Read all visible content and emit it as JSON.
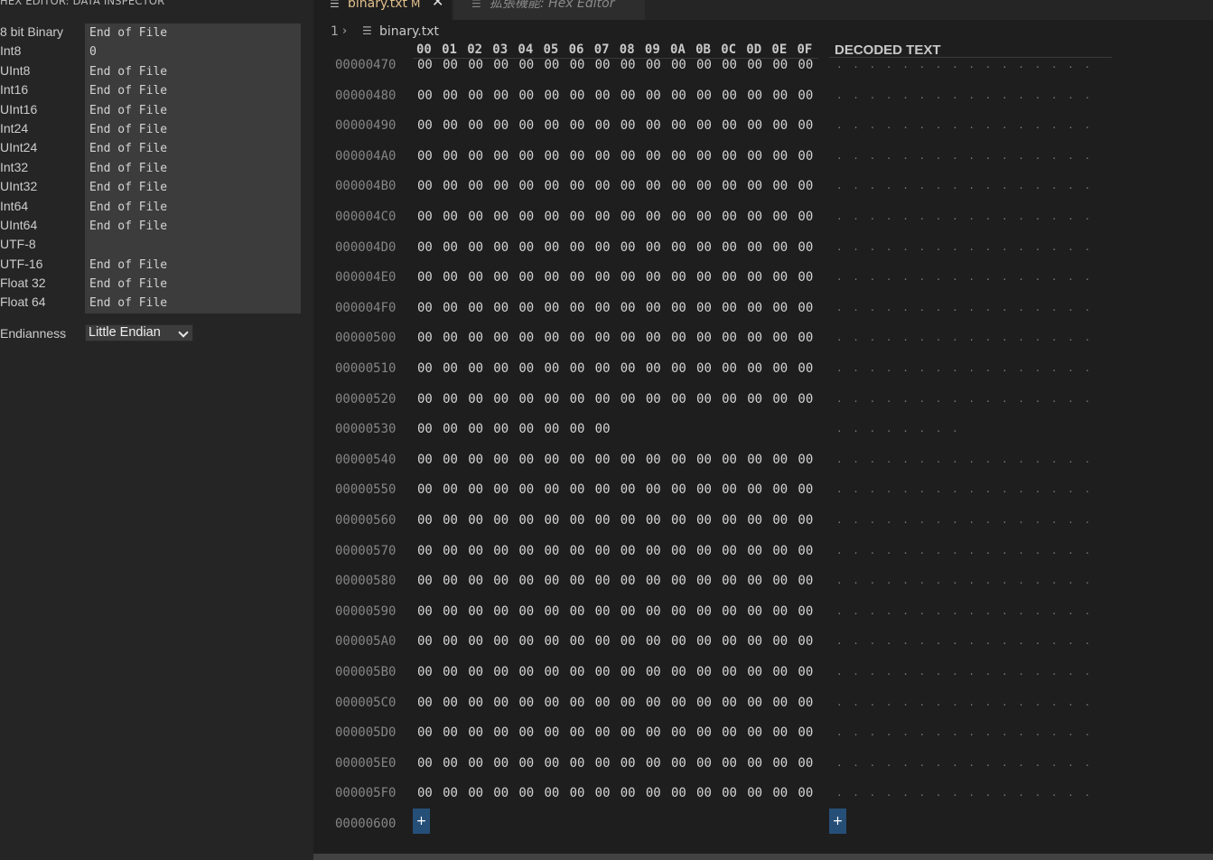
{
  "inspector": {
    "title": "HEX EDITOR: DATA INSPECTOR",
    "rows": [
      {
        "label": "8 bit Binary",
        "value": "End of File"
      },
      {
        "label": "Int8",
        "value": "0"
      },
      {
        "label": "UInt8",
        "value": "End of File"
      },
      {
        "label": "Int16",
        "value": "End of File"
      },
      {
        "label": "UInt16",
        "value": "End of File"
      },
      {
        "label": "Int24",
        "value": "End of File"
      },
      {
        "label": "UInt24",
        "value": "End of File"
      },
      {
        "label": "Int32",
        "value": "End of File"
      },
      {
        "label": "UInt32",
        "value": "End of File"
      },
      {
        "label": "Int64",
        "value": "End of File"
      },
      {
        "label": "UInt64",
        "value": "End of File"
      },
      {
        "label": "UTF-8",
        "value": ""
      },
      {
        "label": "UTF-16",
        "value": "End of File"
      },
      {
        "label": "Float 32",
        "value": "End of File"
      },
      {
        "label": "Float 64",
        "value": "End of File"
      }
    ],
    "endianness_label": "Endianness",
    "endianness_value": "Little Endian"
  },
  "tabs": [
    {
      "label": "binary.txt",
      "modified": "M",
      "close": "✕",
      "icon": "file-lines-icon"
    },
    {
      "label": "拡張機能: Hex Editor",
      "icon": "file-lines-icon"
    }
  ],
  "breadcrumb": {
    "line": "1",
    "separator": "›",
    "file": "binary.txt"
  },
  "hex": {
    "header_cols": [
      "00",
      "01",
      "02",
      "03",
      "04",
      "05",
      "06",
      "07",
      "08",
      "09",
      "0A",
      "0B",
      "0C",
      "0D",
      "0E",
      "0F"
    ],
    "decoded_header": "DECODED TEXT",
    "rows": [
      {
        "addr": "00000470",
        "count": 16
      },
      {
        "addr": "00000480",
        "count": 16
      },
      {
        "addr": "00000490",
        "count": 16
      },
      {
        "addr": "000004A0",
        "count": 16
      },
      {
        "addr": "000004B0",
        "count": 16
      },
      {
        "addr": "000004C0",
        "count": 16
      },
      {
        "addr": "000004D0",
        "count": 16
      },
      {
        "addr": "000004E0",
        "count": 16
      },
      {
        "addr": "000004F0",
        "count": 16
      },
      {
        "addr": "00000500",
        "count": 16
      },
      {
        "addr": "00000510",
        "count": 16
      },
      {
        "addr": "00000520",
        "count": 16
      },
      {
        "addr": "00000530",
        "count": 8
      },
      {
        "addr": "00000540",
        "count": 16
      },
      {
        "addr": "00000550",
        "count": 16
      },
      {
        "addr": "00000560",
        "count": 16
      },
      {
        "addr": "00000570",
        "count": 16
      },
      {
        "addr": "00000580",
        "count": 16
      },
      {
        "addr": "00000590",
        "count": 16
      },
      {
        "addr": "000005A0",
        "count": 16
      },
      {
        "addr": "000005B0",
        "count": 16
      },
      {
        "addr": "000005C0",
        "count": 16
      },
      {
        "addr": "000005D0",
        "count": 16
      },
      {
        "addr": "000005E0",
        "count": 16
      },
      {
        "addr": "000005F0",
        "count": 16
      }
    ],
    "byte_value": "00",
    "decoded_char": ".",
    "final_addr": "00000600",
    "add_label": "+"
  },
  "colors": {
    "accent": "#264f78",
    "modified_tab": "#e2c08d"
  }
}
